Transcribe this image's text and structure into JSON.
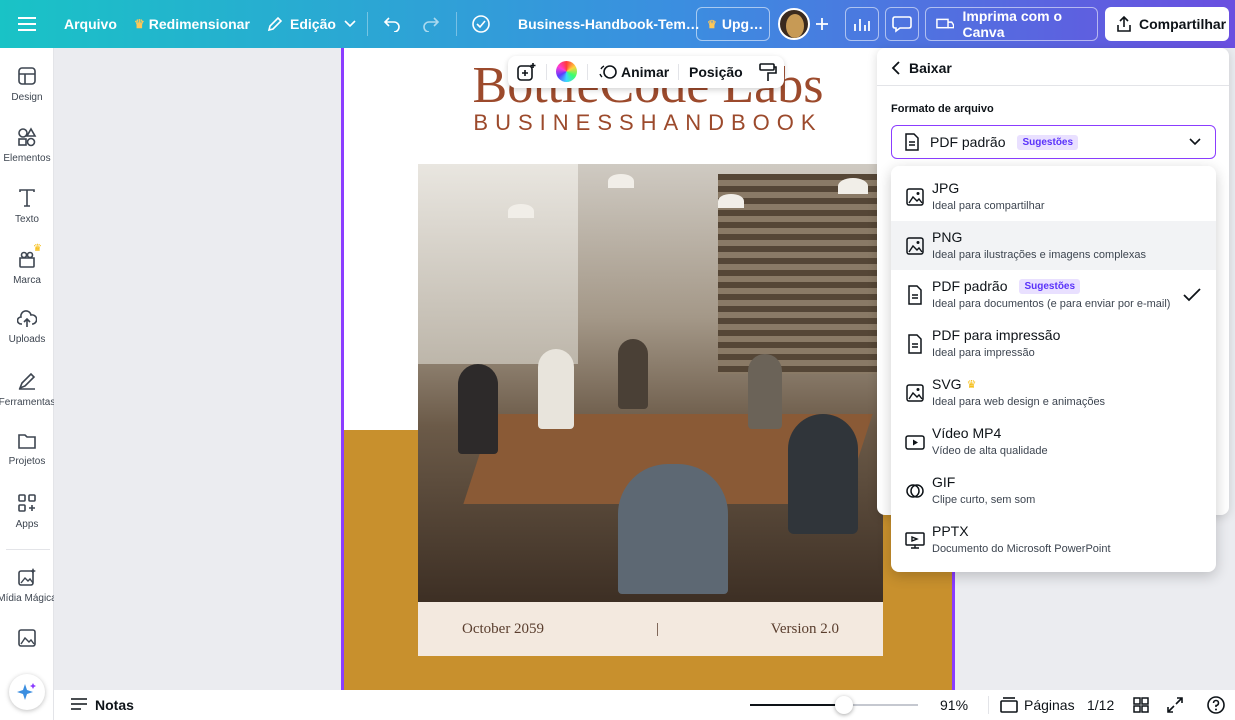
{
  "topbar": {
    "file_label": "Arquivo",
    "resize_label": "Redimensionar",
    "edit_label": "Edição",
    "doc_title": "Business-Handbook-Tem…",
    "upgrade_label": "Upg…",
    "print_label": "Imprima com o Canva",
    "share_label": "Compartilhar"
  },
  "sidebar": {
    "items": [
      {
        "label": "Design",
        "icon": "layout-icon"
      },
      {
        "label": "Elementos",
        "icon": "shapes-icon"
      },
      {
        "label": "Texto",
        "icon": "text-icon"
      },
      {
        "label": "Marca",
        "icon": "brand-icon"
      },
      {
        "label": "Uploads",
        "icon": "cloud-upload-icon"
      },
      {
        "label": "Ferramentas",
        "icon": "pen-icon"
      },
      {
        "label": "Projetos",
        "icon": "folder-icon"
      },
      {
        "label": "Apps",
        "icon": "apps-icon"
      },
      {
        "label": "Mídia Mágica",
        "icon": "magic-media-icon"
      }
    ]
  },
  "context_toolbar": {
    "animate_label": "Animar",
    "position_label": "Posição"
  },
  "page": {
    "brand": "BottleCode Labs",
    "subtitle": "BUSINESSHANDBOOK",
    "date": "October 2059",
    "separator": "|",
    "version": "Version 2.0"
  },
  "download_panel": {
    "back_label": "Baixar",
    "format_label": "Formato de arquivo",
    "selected_value": "PDF padrão",
    "selected_badge": "Sugestões"
  },
  "formats": [
    {
      "title": "JPG",
      "desc": "Ideal para compartilhar",
      "icon": "image-icon"
    },
    {
      "title": "PNG",
      "desc": "Ideal para ilustrações e imagens complexas",
      "icon": "image-icon"
    },
    {
      "title": "PDF padrão",
      "desc": "Ideal para documentos (e para enviar por e-mail)",
      "badge": "Sugestões",
      "icon": "document-icon"
    },
    {
      "title": "PDF para impressão",
      "desc": "Ideal para impressão",
      "icon": "document-icon"
    },
    {
      "title": "SVG",
      "desc": "Ideal para web design e animações",
      "icon": "image-icon"
    },
    {
      "title": "Vídeo MP4",
      "desc": "Vídeo de alta qualidade",
      "icon": "video-icon"
    },
    {
      "title": "GIF",
      "desc": "Clipe curto, sem som",
      "icon": "gif-icon"
    },
    {
      "title": "PPTX",
      "desc": "Documento do Microsoft PowerPoint",
      "icon": "presentation-icon"
    }
  ],
  "bottombar": {
    "notes_label": "Notas",
    "zoom": "91%",
    "pages_label": "Páginas",
    "page_counter": "1/12"
  },
  "colors": {
    "accent": "#8b3dff",
    "brand_text": "#9c4a2c",
    "gold": "#c8902d"
  }
}
